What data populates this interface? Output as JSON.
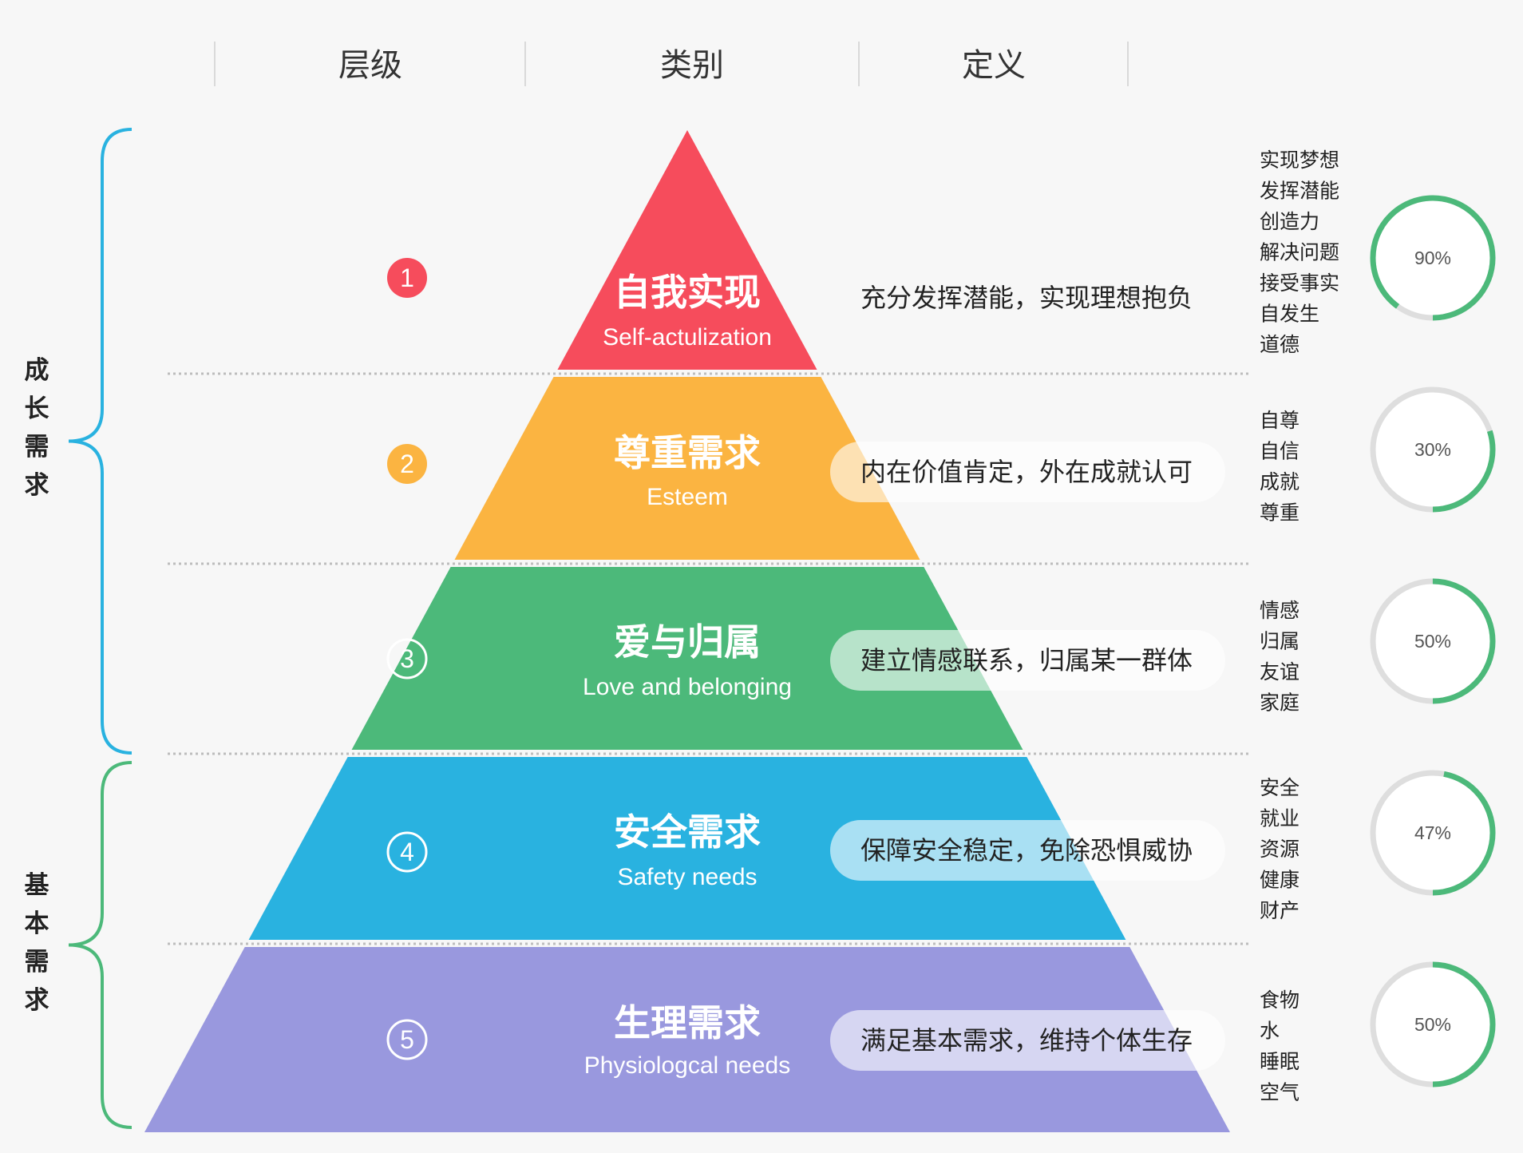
{
  "headers": {
    "level": "层级",
    "category": "类别",
    "definition": "定义"
  },
  "groups": {
    "growth": {
      "label": "成长需求",
      "color": "#29b2e0"
    },
    "basic": {
      "label": "基本需求",
      "color": "#4cb97a"
    }
  },
  "tiers": [
    {
      "num": "1",
      "name_cn": "自我实现",
      "name_en": "Self-actulization",
      "color": "#f64c5c",
      "definition": "充分发挥潜能，实现理想抱负",
      "keywords": [
        "实现梦想",
        "发挥潜能",
        "创造力",
        "解决问题",
        "接受事实",
        "自发生",
        "道德"
      ],
      "progress": 0.9,
      "progress_label": "90%"
    },
    {
      "num": "2",
      "name_cn": "尊重需求",
      "name_en": "Esteem",
      "color": "#fbb441",
      "definition": "内在价值肯定，外在成就认可",
      "keywords": [
        "自尊",
        "自信",
        "成就",
        "尊重"
      ],
      "progress": 0.3,
      "progress_label": "30%"
    },
    {
      "num": "3",
      "name_cn": "爱与归属",
      "name_en": "Love and belonging",
      "color": "#4cb97a",
      "definition": "建立情感联系，归属某一群体",
      "keywords": [
        "情感",
        "归属",
        "友谊",
        "家庭"
      ],
      "progress": 0.5,
      "progress_label": "50%"
    },
    {
      "num": "4",
      "name_cn": "安全需求",
      "name_en": "Safety needs",
      "color": "#29b2e0",
      "definition": "保障安全稳定，免除恐惧威协",
      "keywords": [
        "安全",
        "就业",
        "资源",
        "健康",
        "财产"
      ],
      "progress": 0.47,
      "progress_label": "47%"
    },
    {
      "num": "5",
      "name_cn": "生理需求",
      "name_en": "Physiologcal needs",
      "color": "#9998de",
      "definition": "满足基本需求，维持个体生存",
      "keywords": [
        "食物",
        "水",
        "睡眠",
        "空气"
      ],
      "progress": 0.5,
      "progress_label": "50%"
    }
  ],
  "ring_color": "#4cb97a",
  "ring_track_color": "#dedede"
}
